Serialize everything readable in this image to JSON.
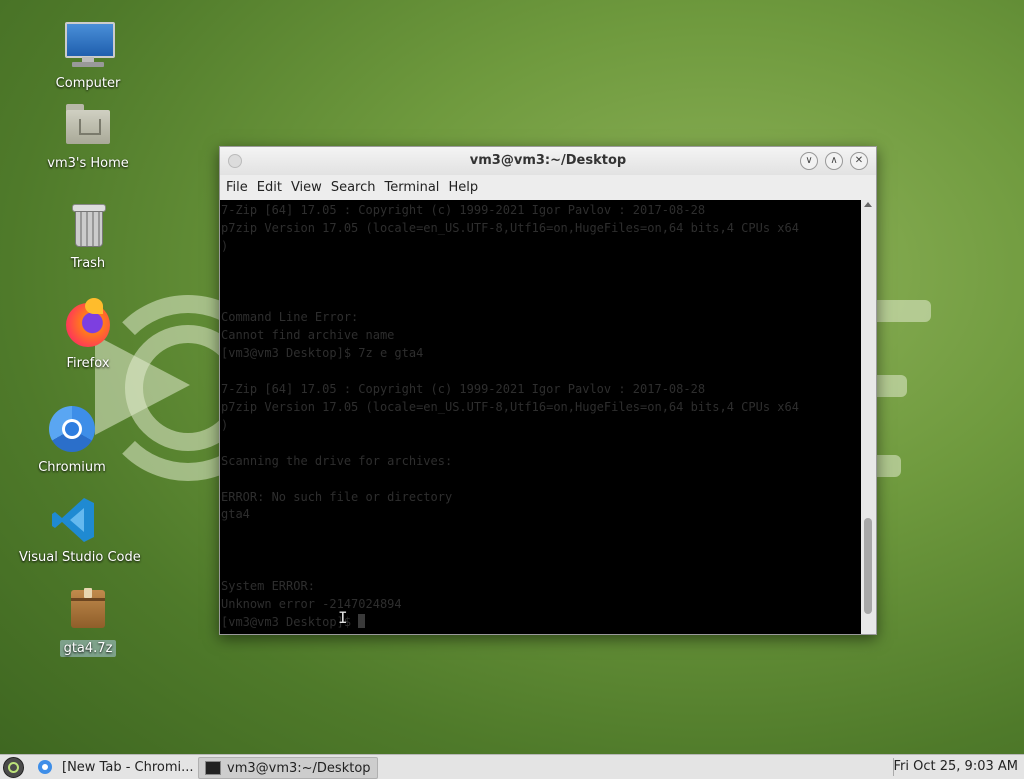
{
  "desktop": {
    "icons": [
      {
        "label": "Computer",
        "icon": "computer-icon"
      },
      {
        "label": "vm3's Home",
        "icon": "home-folder-icon"
      },
      {
        "label": "Trash",
        "icon": "trash-icon"
      },
      {
        "label": "Firefox",
        "icon": "firefox-icon"
      },
      {
        "label": "Chromium",
        "icon": "chromium-icon"
      },
      {
        "label": "Visual Studio Code",
        "icon": "vscode-icon"
      },
      {
        "label": "gta4.7z",
        "icon": "archive-icon"
      }
    ]
  },
  "window": {
    "title": "vm3@vm3:~/Desktop",
    "menu": [
      "File",
      "Edit",
      "View",
      "Search",
      "Terminal",
      "Help"
    ],
    "terminal_lines": [
      "7-Zip [64] 17.05 : Copyright (c) 1999-2021 Igor Pavlov : 2017-08-28",
      "p7zip Version 17.05 (locale=en_US.UTF-8,Utf16=on,HugeFiles=on,64 bits,4 CPUs x64",
      ")",
      "",
      "",
      "",
      "Command Line Error:",
      "Cannot find archive name",
      "[vm3@vm3 Desktop]$ 7z e gta4",
      "",
      "7-Zip [64] 17.05 : Copyright (c) 1999-2021 Igor Pavlov : 2017-08-28",
      "p7zip Version 17.05 (locale=en_US.UTF-8,Utf16=on,HugeFiles=on,64 bits,4 CPUs x64",
      ")",
      "",
      "Scanning the drive for archives:",
      "",
      "ERROR: No such file or directory",
      "gta4",
      "",
      "",
      "",
      "System ERROR:",
      "Unknown error -2147024894",
      "[vm3@vm3 Desktop]$ "
    ]
  },
  "taskbar": {
    "items": [
      {
        "label": "[New Tab - Chromi...",
        "icon": "chromium-icon"
      },
      {
        "label": "vm3@vm3:~/Desktop",
        "icon": "terminal-icon"
      }
    ],
    "clock": "Fri Oct 25,  9:03 AM"
  }
}
